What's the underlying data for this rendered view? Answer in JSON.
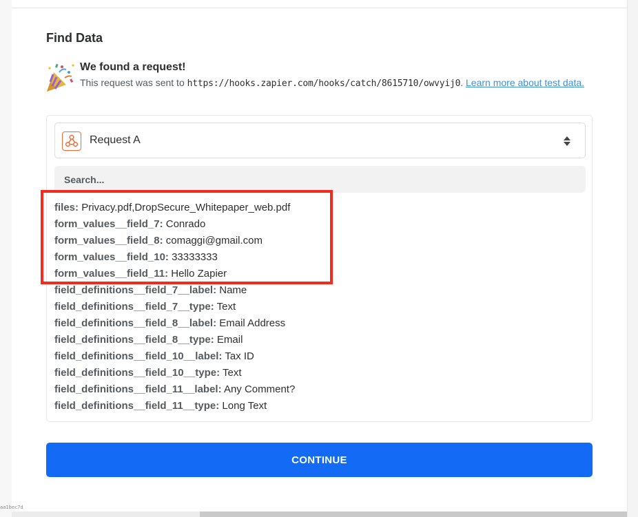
{
  "section": {
    "title": "Find Data"
  },
  "found": {
    "title": "We found a request!",
    "desc_prefix": "This request was sent to ",
    "url": "https://hooks.zapier.com/hooks/catch/8615710/owvyij0",
    "desc_suffix": ". ",
    "link_text": "Learn more about test data."
  },
  "request_select": {
    "label": "Request A"
  },
  "search": {
    "placeholder": "Search..."
  },
  "fields": [
    {
      "key": "files:",
      "value": "Privacy.pdf,DropSecure_Whitepaper_web.pdf"
    },
    {
      "key": "form_values__field_7:",
      "value": "Conrado"
    },
    {
      "key": "form_values__field_8:",
      "value": "comaggi@gmail.com"
    },
    {
      "key": "form_values__field_10:",
      "value": "33333333"
    },
    {
      "key": "form_values__field_11:",
      "value": "Hello Zapier"
    },
    {
      "key": "field_definitions__field_7__label:",
      "value": "Name"
    },
    {
      "key": "field_definitions__field_7__type:",
      "value": "Text"
    },
    {
      "key": "field_definitions__field_8__label:",
      "value": "Email Address"
    },
    {
      "key": "field_definitions__field_8__type:",
      "value": "Email"
    },
    {
      "key": "field_definitions__field_10__label:",
      "value": "Tax ID"
    },
    {
      "key": "field_definitions__field_10__type:",
      "value": "Text"
    },
    {
      "key": "field_definitions__field_11__label:",
      "value": "Any Comment?"
    },
    {
      "key": "field_definitions__field_11__type:",
      "value": "Long Text"
    }
  ],
  "actions": {
    "continue_label": "CONTINUE"
  },
  "footer": {
    "build_tag": "aa1bec7d"
  },
  "colors": {
    "primary_button": "#136bf5",
    "highlight": "#f52a1c",
    "webhook_accent": "#f06a35",
    "link": "#3d8fe0"
  },
  "icons": {
    "celebration": "party-popper-icon",
    "webhook": "webhook-icon",
    "select_toggle": "up-down-chevron-icon"
  }
}
